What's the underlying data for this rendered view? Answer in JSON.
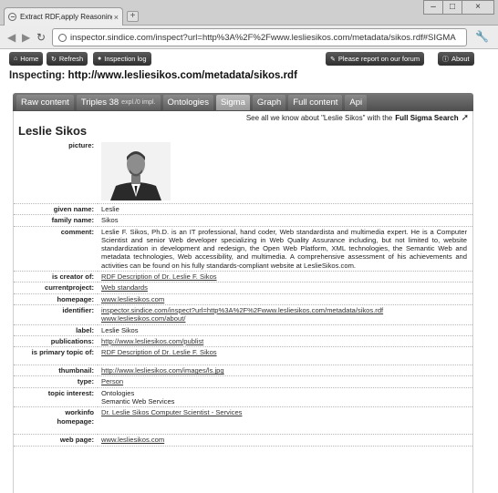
{
  "browser": {
    "tab_title": "Extract RDF,apply Reasoning",
    "tab_close": "×",
    "new_tab": "+",
    "url": "inspector.sindice.com/inspect?url=http%3A%2F%2Fwww.lesliesikos.com/metadata/sikos.rdf#SIGMA",
    "win_min": "–",
    "win_max": "□",
    "win_close": "×"
  },
  "appbar": {
    "home": "Home",
    "refresh": "Refresh",
    "inspection_log": "Inspection log",
    "report": "Please report on our forum",
    "about": "About"
  },
  "inspecting": {
    "label": "Inspecting:",
    "url": "http://www.lesliesikos.com/metadata/sikos.rdf"
  },
  "tabs": [
    {
      "label": "Raw content",
      "sub": ""
    },
    {
      "label": "Triples 38",
      "sub": "expl./0 impl."
    },
    {
      "label": "Ontologies",
      "sub": ""
    },
    {
      "label": "Sigma",
      "sub": ""
    },
    {
      "label": "Graph",
      "sub": ""
    },
    {
      "label": "Full content",
      "sub": ""
    },
    {
      "label": "Api",
      "sub": ""
    }
  ],
  "sigma": {
    "all_know": "See all we know about \"Leslie Sikos\" with the",
    "full_search": "Full Sigma Search",
    "name": "Leslie Sikos"
  },
  "props": {
    "picture": "picture:",
    "given_name_k": "given name:",
    "given_name_v": "Leslie",
    "family_name_k": "family name:",
    "family_name_v": "Sikos",
    "comment_k": "comment:",
    "comment_v": "Leslie F. Sikos, Ph.D. is an IT professional, hand coder, Web standardista and multimedia expert. He is a Computer Scientist and senior Web developer specializing in Web Quality Assurance including, but not limited to, website standardization in development and redesign, the Open Web Platform, XML technologies, the Semantic Web and metadata technologies, Web accessibility, and multimedia. A comprehensive assessment of his achievements and activities can be found on his fully standards-compliant website at LeslieSikos.com.",
    "creator_k": "is creator of:",
    "creator_v": "RDF Description of Dr. Leslie F. Sikos",
    "project_k": "currentproject:",
    "project_v": "Web standards",
    "homepage_k": "homepage:",
    "homepage_v": "www.lesliesikos.com",
    "identifier_k": "identifier:",
    "identifier_v1": "inspector.sindice.com/inspect?url=http%3A%2F%2Fwww.lesliesikos.com/metadata/sikos.rdf",
    "identifier_v2": "www.lesliesikos.com/about/",
    "label_k": "label:",
    "label_v": "Leslie Sikos",
    "publications_k": "publications:",
    "publications_v": "http://www.lesliesikos.com/publist",
    "primary_k": "is primary topic of:",
    "primary_v": "RDF Description of Dr. Leslie F. Sikos",
    "thumbnail_k": "thumbnail:",
    "thumbnail_v": "http://www.lesliesikos.com/images/ls.jpg",
    "type_k": "type:",
    "type_v": "Person",
    "interest_k": "topic interest:",
    "interest_v1": "Ontologies",
    "interest_v2": "Semantic Web Services",
    "workinfo_k1": "workinfo",
    "workinfo_k2": "homepage:",
    "workinfo_v": "Dr. Leslie Sikos Computer Scientist - Services",
    "webpage_k": "web page:",
    "webpage_v": "www.lesliesikos.com"
  }
}
